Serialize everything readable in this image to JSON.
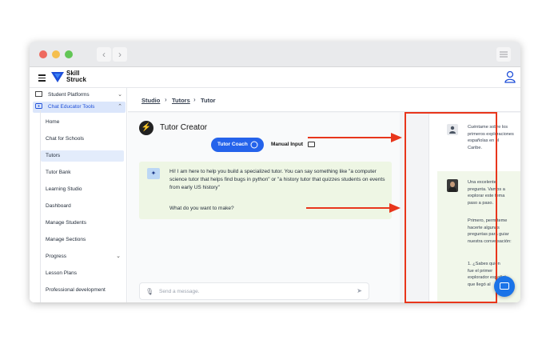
{
  "window": {
    "logo_text_line1": "Skill",
    "logo_text_line2": "Struck"
  },
  "sidebar": {
    "top_items": [
      {
        "label": "Student Platforms",
        "icon": "monitor-icon",
        "expanded": false
      },
      {
        "label": "Chat Educator Tools",
        "icon": "chat-icon",
        "expanded": true
      }
    ],
    "sub_items": [
      {
        "label": "Home"
      },
      {
        "label": "Chat for Schools"
      },
      {
        "label": "Tutors",
        "active": true
      },
      {
        "label": "Tutor Bank"
      },
      {
        "label": "Learning Studio"
      },
      {
        "label": "Dashboard"
      },
      {
        "label": "Manage Students"
      },
      {
        "label": "Manage Sections"
      },
      {
        "label": "Progress",
        "has_chevron": true
      },
      {
        "label": "Lesson Plans"
      },
      {
        "label": "Professional development"
      }
    ]
  },
  "breadcrumbs": [
    "Studio",
    "Tutors",
    "Tutor"
  ],
  "tutor_creator": {
    "title": "Tutor Creator",
    "tab_coach": "Tutor Coach",
    "tab_manual": "Manual Input",
    "intro_message": "Hi! I am here to help you build a specialized tutor. You can say something like \"a computer science tutor that helps find bugs in python\" or \"a history tutor that quizzes students on events from early US history\"",
    "question": "What do you want to make?",
    "input_placeholder": "Send a message."
  },
  "preview": {
    "user_message": "Cuéntame sobre los primeros exploraciones españolas en el Caribe.",
    "bot_message_p1": "Una excelente pregunta. Vamos a explorar este tema paso a paso.",
    "bot_message_p2": "Primero, permíteme hacerte algunas preguntas para guiar nuestra conversación:",
    "bot_list_item": "1. ¿Sabes quién fue el primer explorador español que llegó al"
  },
  "colors": {
    "accent": "#2563eb",
    "annotation_red": "#e8361c",
    "message_bg": "#eef6e4"
  }
}
